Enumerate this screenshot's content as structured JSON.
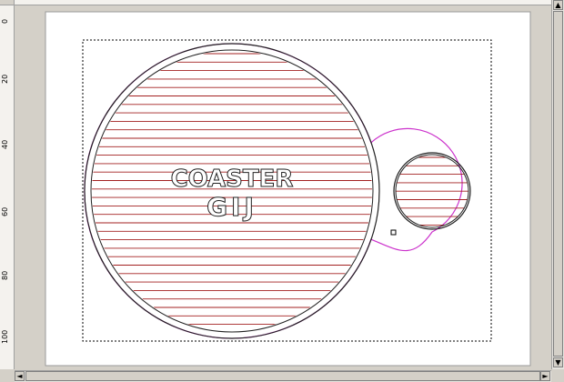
{
  "window": {
    "title": ""
  },
  "rulers": {
    "top_labels": [
      "",
      "",
      "",
      "",
      "",
      "",
      "",
      "",
      ""
    ],
    "left_labels": [
      "0",
      "20",
      "40",
      "60",
      "80",
      "100"
    ]
  },
  "design": {
    "logo_line1": "COASTER",
    "logo_line2": "GIJ",
    "colors": {
      "outline_magenta": "#cc33cc",
      "cut_black": "#222222",
      "hatch_red": "#a32020",
      "bbox": "#000000",
      "page": "#ffffff"
    }
  },
  "icons": {
    "scroll_up": "▲",
    "scroll_down": "▼",
    "scroll_left": "◄",
    "scroll_right": "►"
  }
}
